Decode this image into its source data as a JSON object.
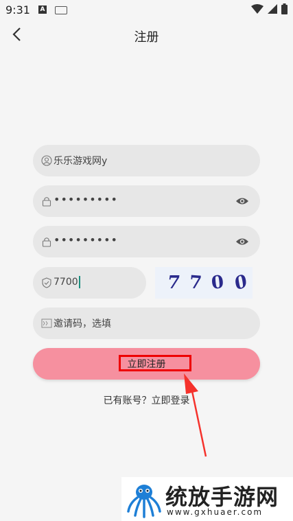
{
  "status": {
    "time": "9:31",
    "notify_letter": "A"
  },
  "header": {
    "title": "注册"
  },
  "form": {
    "username_value": "乐乐游戏网y",
    "password_mask": "•••••••••",
    "confirm_mask": "•••••••••",
    "captcha_value": "7700",
    "captcha_chars": [
      "7",
      "7",
      "0",
      "0"
    ],
    "invite_placeholder": "邀请码，选填"
  },
  "submit_label": "立即注册",
  "login_link": "已有账号？立即登录",
  "watermark": {
    "name": "统放手游网",
    "url": "www.gxhuaer.com"
  },
  "colors": {
    "primary": "#f6909f",
    "highlight": "#ee0000",
    "field_bg": "#e7e7e7"
  }
}
